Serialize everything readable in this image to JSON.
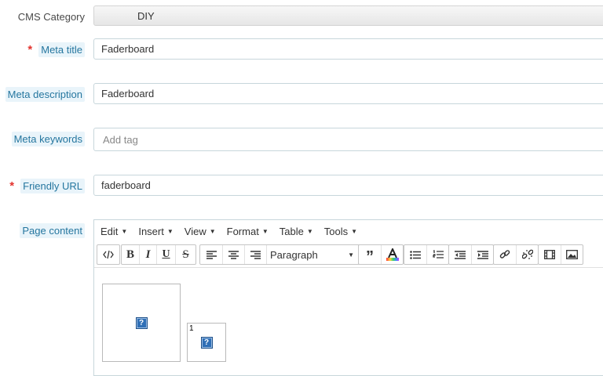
{
  "form": {
    "cms_category": {
      "label": "CMS Category",
      "value": "DIY"
    },
    "meta_title": {
      "label": "Meta title",
      "required": true,
      "value": "Faderboard"
    },
    "meta_description": {
      "label": "Meta description",
      "value": "Faderboard"
    },
    "meta_keywords": {
      "label": "Meta keywords",
      "placeholder": "Add tag"
    },
    "friendly_url": {
      "label": "Friendly URL",
      "required": true,
      "value": "faderboard"
    },
    "page_content": {
      "label": "Page content"
    }
  },
  "required_mark": "*",
  "editor": {
    "menus": [
      "Edit",
      "Insert",
      "View",
      "Format",
      "Table",
      "Tools"
    ],
    "block_format": "Paragraph",
    "toolbar_icons": [
      "code-icon",
      "bold-icon",
      "italic-icon",
      "underline-icon",
      "strikethrough-icon",
      "align-left-icon",
      "align-center-icon",
      "align-right-icon",
      "blockquote-icon",
      "text-color-icon",
      "bullet-list-icon",
      "numbered-list-icon",
      "outdent-icon",
      "indent-icon",
      "link-icon",
      "unlink-icon",
      "media-icon",
      "image-icon"
    ],
    "content": {
      "broken_image_icon": "?",
      "table_cell_text": "1"
    }
  },
  "colors": {
    "hint_label": "#25769f",
    "hint_bg": "#e9f4fa",
    "required": "#e3342f",
    "field_border": "#c7d6db"
  }
}
